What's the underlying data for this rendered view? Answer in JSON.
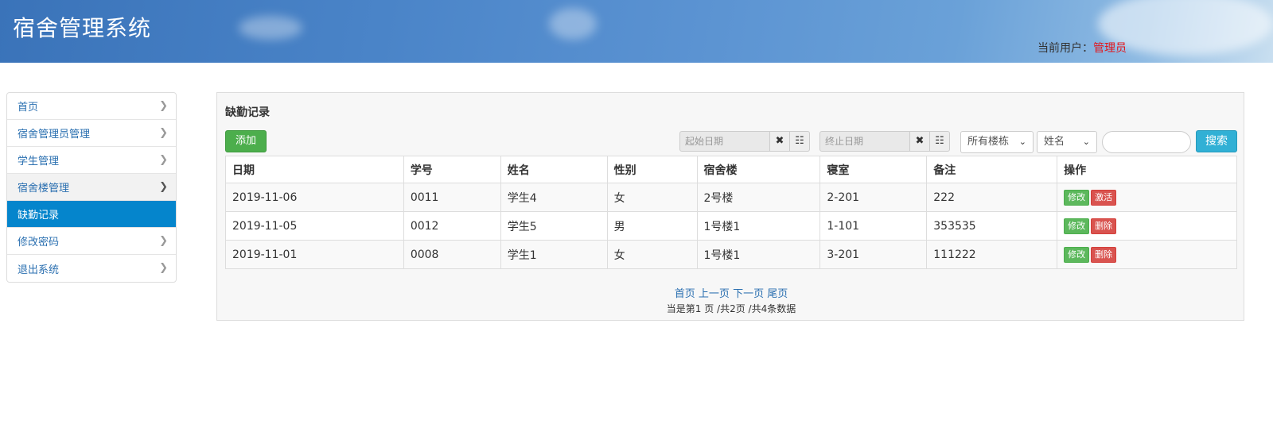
{
  "header": {
    "app_title": "宿舍管理系统",
    "user_label": "当前用户：",
    "user_name": "管理员"
  },
  "sidebar": {
    "items": [
      {
        "label": "首页"
      },
      {
        "label": "宿舍管理员管理"
      },
      {
        "label": "学生管理"
      },
      {
        "label": "宿舍楼管理"
      },
      {
        "label": "缺勤记录"
      },
      {
        "label": "修改密码"
      },
      {
        "label": "退出系统"
      }
    ],
    "active_index": 4
  },
  "panel": {
    "title": "缺勤记录",
    "add_label": "添加",
    "start_date_placeholder": "起始日期",
    "end_date_placeholder": "终止日期",
    "clear_icon": "times-icon",
    "calendar_icon": "grid-icon",
    "building_select_value": "所有楼栋",
    "field_select_value": "姓名",
    "search_label": "搜索"
  },
  "table": {
    "headers": [
      "日期",
      "学号",
      "姓名",
      "性别",
      "宿舍楼",
      "寝室",
      "备注",
      "操作"
    ],
    "rows": [
      {
        "date": "2019-11-06",
        "id": "0011",
        "name": "学生4",
        "gender": "女",
        "building": "2号楼",
        "room": "2-201",
        "note": "222",
        "edit": "修改",
        "action2": "激活"
      },
      {
        "date": "2019-11-05",
        "id": "0012",
        "name": "学生5",
        "gender": "男",
        "building": "1号楼1",
        "room": "1-101",
        "note": "353535",
        "edit": "修改",
        "action2": "删除"
      },
      {
        "date": "2019-11-01",
        "id": "0008",
        "name": "学生1",
        "gender": "女",
        "building": "1号楼1",
        "room": "3-201",
        "note": "111222",
        "edit": "修改",
        "action2": "删除"
      }
    ]
  },
  "pager": {
    "first": "首页",
    "prev": "上一页",
    "next": "下一页",
    "last": "尾页",
    "info": "当是第1 页 /共2页  /共4条数据"
  },
  "colors": {
    "accent": "#0585cc",
    "user_name": "#e4161b",
    "success": "#5cb85c",
    "danger": "#d9534f",
    "info": "#31b0d5"
  }
}
